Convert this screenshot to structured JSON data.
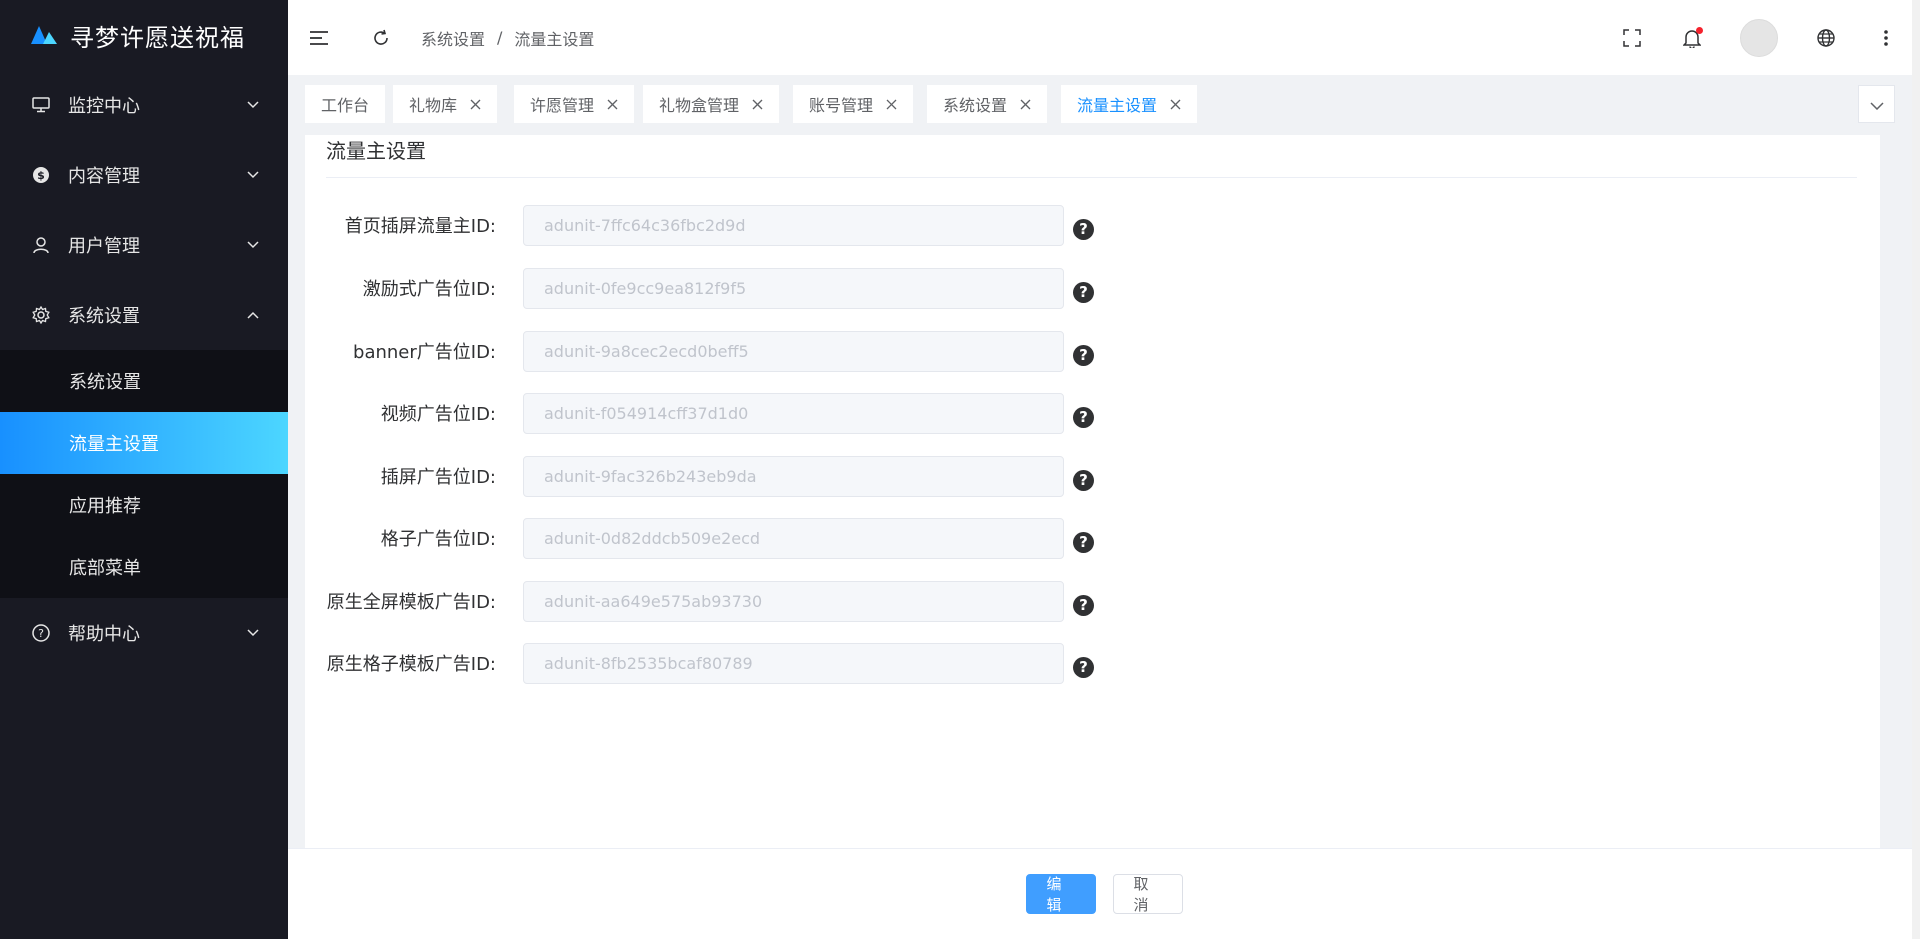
{
  "app": {
    "title": "寻梦许愿送祝福",
    "logo_icon": "mountain-logo-icon",
    "accent_color": "#1890ff"
  },
  "sidebar": {
    "menu": [
      {
        "label": "监控中心",
        "icon": "monitor-icon",
        "expanded": false
      },
      {
        "label": "内容管理",
        "icon": "dollar-circle-icon",
        "expanded": false
      },
      {
        "label": "用户管理",
        "icon": "user-icon",
        "expanded": false
      },
      {
        "label": "系统设置",
        "icon": "gear-icon",
        "expanded": true,
        "children": [
          {
            "label": "系统设置",
            "active": false
          },
          {
            "label": "流量主设置",
            "active": true
          },
          {
            "label": "应用推荐",
            "active": false
          },
          {
            "label": "底部菜单",
            "active": false
          }
        ]
      },
      {
        "label": "帮助中心",
        "icon": "question-circle-icon",
        "expanded": false
      }
    ]
  },
  "header": {
    "breadcrumb": [
      "系统设置",
      "流量主设置"
    ],
    "breadcrumb_sep": "/",
    "icons": [
      "menu-fold-icon",
      "refresh-icon",
      "fullscreen-icon",
      "bell-icon",
      "avatar",
      "globe-icon",
      "more-vertical-icon"
    ],
    "has_notification": true
  },
  "tabs": [
    {
      "label": "工作台",
      "closable": false,
      "active": false
    },
    {
      "label": "礼物库",
      "closable": true,
      "active": false
    },
    {
      "label": "许愿管理",
      "closable": true,
      "active": false
    },
    {
      "label": "礼物盒管理",
      "closable": true,
      "active": false
    },
    {
      "label": "账号管理",
      "closable": true,
      "active": false
    },
    {
      "label": "系统设置",
      "closable": true,
      "active": false
    },
    {
      "label": "流量主设置",
      "closable": true,
      "active": true
    }
  ],
  "content": {
    "title": "流量主设置",
    "fields": [
      {
        "label": "首页插屏流量主ID:",
        "value": "adunit-7ffc64c36fbc2d9d"
      },
      {
        "label": "激励式广告位ID:",
        "value": "adunit-0fe9cc9ea812f9f5"
      },
      {
        "label": "banner广告位ID:",
        "value": "adunit-9a8cec2ecd0beff5"
      },
      {
        "label": "视频广告位ID:",
        "value": "adunit-f054914cff37d1d0"
      },
      {
        "label": "插屏广告位ID:",
        "value": "adunit-9fac326b243eb9da"
      },
      {
        "label": "格子广告位ID:",
        "value": "adunit-0d82ddcb509e2ecd"
      },
      {
        "label": "原生全屏模板广告ID:",
        "value": "adunit-aa649e575ab93730"
      },
      {
        "label": "原生格子模板广告ID:",
        "value": "adunit-8fb2535bcaf80789"
      }
    ],
    "help_glyph": "?"
  },
  "footer": {
    "edit_label": "编辑",
    "cancel_label": "取消"
  }
}
